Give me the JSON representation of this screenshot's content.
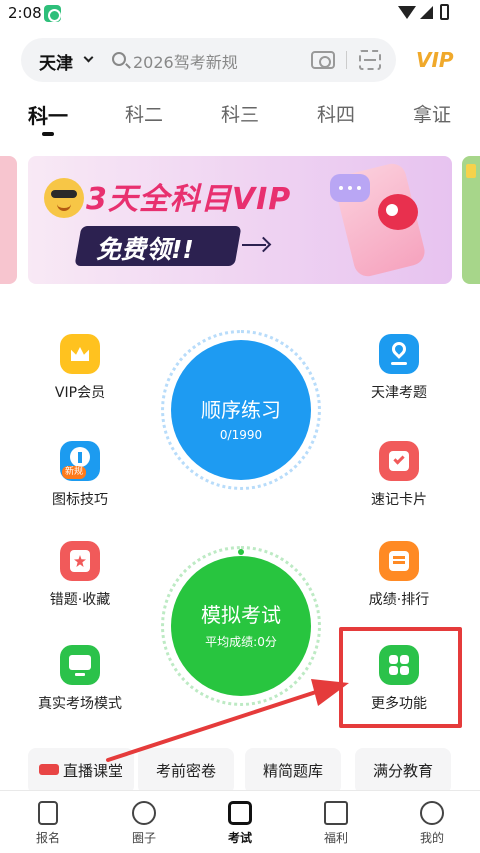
{
  "status_bar": {
    "time": "2:08"
  },
  "header": {
    "city": "天津",
    "search_placeholder": "2026驾考新规",
    "vip_label": "VIP"
  },
  "tabs": [
    {
      "label": "科一",
      "active": true
    },
    {
      "label": "科二",
      "active": false
    },
    {
      "label": "科三",
      "active": false
    },
    {
      "label": "科四",
      "active": false
    },
    {
      "label": "拿证",
      "active": false
    }
  ],
  "banner": {
    "title": "3天全科目VIP",
    "cta": "免费领!!"
  },
  "left_features": [
    {
      "label": "VIP会员",
      "icon": "crown-icon",
      "color": "#ffc21f"
    },
    {
      "label": "图标技巧",
      "icon": "upload-icon",
      "color": "#1c9bf0",
      "badge": "新规"
    },
    {
      "label": "错题·收藏",
      "icon": "star-icon",
      "color": "#f15a5a"
    },
    {
      "label": "真实考场模式",
      "icon": "monitor-icon",
      "color": "#2bc24a"
    }
  ],
  "right_features": [
    {
      "label": "天津考题",
      "icon": "location-pin-icon",
      "color": "#1c9bf0"
    },
    {
      "label": "速记卡片",
      "icon": "check-card-icon",
      "color": "#f15a5a"
    },
    {
      "label": "成绩·排行",
      "icon": "list-icon",
      "color": "#ff8a24"
    },
    {
      "label": "更多功能",
      "icon": "grid-icon",
      "color": "#2bc24a"
    }
  ],
  "practice_circle": {
    "title": "顺序练习",
    "progress": "0/1990",
    "color": "#1e9bf2"
  },
  "exam_circle": {
    "title": "模拟考试",
    "subtitle": "平均成绩:0分",
    "color": "#28c53f"
  },
  "quick_links": [
    {
      "label": "直播课堂"
    },
    {
      "label": "考前密卷"
    },
    {
      "label": "精简题库"
    },
    {
      "label": "满分教育"
    }
  ],
  "bottom_nav": [
    {
      "label": "报名",
      "icon": "document-icon",
      "active": false
    },
    {
      "label": "圈子",
      "icon": "chat-icon",
      "active": false
    },
    {
      "label": "考试",
      "icon": "wallet-icon",
      "active": true
    },
    {
      "label": "福利",
      "icon": "gift-icon",
      "active": false
    },
    {
      "label": "我的",
      "icon": "profile-icon",
      "active": false
    }
  ],
  "annotation": {
    "color": "#e53b3b"
  }
}
